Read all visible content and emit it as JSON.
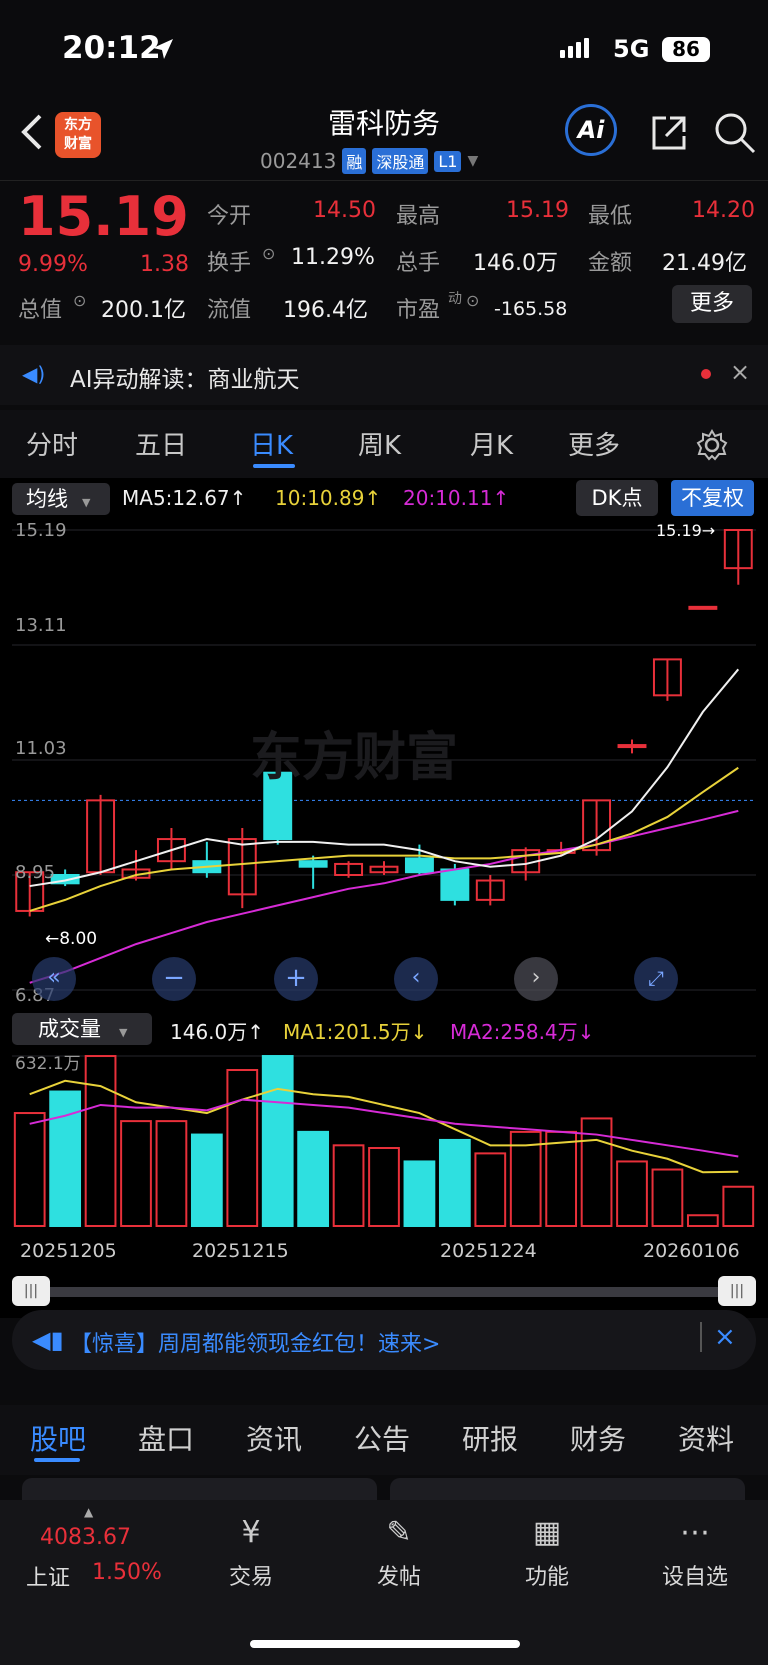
{
  "status": {
    "time": "20:12",
    "network": "5G",
    "battery": "86"
  },
  "header": {
    "title": "雷科防务",
    "code": "002413",
    "tags": [
      "融",
      "深股通",
      "L1"
    ],
    "logo_text": "东方财富",
    "ai_label": "Ai"
  },
  "quote": {
    "price": "15.19",
    "change_pct": "9.99%",
    "change": "1.38",
    "open_label": "今开",
    "open": "14.50",
    "high_label": "最高",
    "high": "15.19",
    "low_label": "最低",
    "low": "14.20",
    "turnover_label": "换手",
    "turnover": "11.29%",
    "volume_label": "总手",
    "volume": "146.0万",
    "amount_label": "金额",
    "amount": "21.49亿",
    "mktcap_label": "总值",
    "mktcap": "200.1亿",
    "float_label": "流值",
    "float": "196.4亿",
    "pe_label": "市盈",
    "pe_sup": "动",
    "pe": "-165.58",
    "more": "更多"
  },
  "ai_bar": {
    "text": "AI异动解读：商业航天"
  },
  "chart_tabs": [
    "分时",
    "五日",
    "日K",
    "周K",
    "月K",
    "更多"
  ],
  "chart_controls": {
    "ma_label": "均线",
    "ma5": "MA5:12.67↑",
    "ma10": "10:10.89↑",
    "ma20": "20:10.11↑",
    "dk": "DK点",
    "adjust": "不复权",
    "last_price_tag": "15.19→",
    "low_tag": "←8.00",
    "y_labels": [
      "15.19",
      "13.11",
      "11.03",
      "8.95",
      "6.87"
    ],
    "watermark": "东方财富"
  },
  "volume_controls": {
    "label": "成交量",
    "value": "146.0万↑",
    "ma1": "MA1:201.5万↓",
    "ma2": "MA2:258.4万↓",
    "max_label": "632.1万"
  },
  "x_labels": [
    "20251205",
    "20251215",
    "20251224",
    "20260106"
  ],
  "colors": {
    "up": "#e8303a",
    "down": "#2ee0e0",
    "ma5": "#f0f0f0",
    "ma10": "#e8d23a",
    "ma20": "#d62bd6",
    "accent": "#2a6fd6"
  },
  "chart_data": {
    "type": "candlestick",
    "candles": [
      {
        "o": 8.3,
        "c": 9.0,
        "h": 9.0,
        "l": 8.2
      },
      {
        "o": 8.95,
        "c": 8.8,
        "h": 9.05,
        "l": 8.75
      },
      {
        "o": 9.0,
        "c": 10.3,
        "h": 10.4,
        "l": 8.95
      },
      {
        "o": 9.05,
        "c": 8.9,
        "h": 9.4,
        "l": 8.85
      },
      {
        "o": 9.2,
        "c": 9.6,
        "h": 9.8,
        "l": 9.05
      },
      {
        "o": 9.2,
        "c": 9.0,
        "h": 9.55,
        "l": 8.9
      },
      {
        "o": 9.6,
        "c": 8.6,
        "h": 9.8,
        "l": 8.35
      },
      {
        "o": 10.8,
        "c": 9.6,
        "h": 10.85,
        "l": 9.5
      },
      {
        "o": 9.2,
        "c": 9.1,
        "h": 9.3,
        "l": 8.7
      },
      {
        "o": 8.95,
        "c": 9.15,
        "h": 9.2,
        "l": 8.9
      },
      {
        "o": 9.0,
        "c": 9.1,
        "h": 9.2,
        "l": 8.95
      },
      {
        "o": 9.25,
        "c": 9.0,
        "h": 9.5,
        "l": 8.95
      },
      {
        "o": 9.05,
        "c": 8.5,
        "h": 9.15,
        "l": 8.4
      },
      {
        "o": 8.5,
        "c": 8.85,
        "h": 8.95,
        "l": 8.4
      },
      {
        "o": 9.0,
        "c": 9.4,
        "h": 9.45,
        "l": 8.85
      },
      {
        "o": 9.35,
        "c": 9.4,
        "h": 9.55,
        "l": 9.3
      },
      {
        "o": 9.4,
        "c": 10.3,
        "h": 10.3,
        "l": 9.3
      },
      {
        "o": 11.3,
        "c": 11.3,
        "h": 11.4,
        "l": 11.15
      },
      {
        "o": 12.2,
        "c": 12.85,
        "h": 12.85,
        "l": 12.1
      },
      {
        "o": 13.8,
        "c": 13.8,
        "h": 13.8,
        "l": 13.8
      },
      {
        "o": 14.5,
        "c": 15.19,
        "h": 15.19,
        "l": 14.2
      }
    ],
    "ma5": [
      8.75,
      8.85,
      9.0,
      9.2,
      9.4,
      9.6,
      9.5,
      9.55,
      9.55,
      9.5,
      9.5,
      9.4,
      9.2,
      9.1,
      9.15,
      9.3,
      9.6,
      10.1,
      10.9,
      11.9,
      12.67
    ],
    "ma10": [
      8.3,
      8.5,
      8.75,
      8.95,
      9.05,
      9.1,
      9.15,
      9.2,
      9.25,
      9.3,
      9.3,
      9.3,
      9.25,
      9.25,
      9.3,
      9.35,
      9.5,
      9.7,
      10.0,
      10.45,
      10.89
    ],
    "ma20": [
      7.0,
      7.2,
      7.45,
      7.7,
      7.9,
      8.1,
      8.25,
      8.4,
      8.55,
      8.7,
      8.8,
      8.95,
      9.05,
      9.15,
      9.3,
      9.4,
      9.5,
      9.65,
      9.8,
      9.95,
      10.11
    ],
    "volume": [
      420,
      500,
      632,
      390,
      390,
      340,
      580,
      632,
      350,
      300,
      290,
      240,
      320,
      270,
      350,
      350,
      400,
      240,
      210,
      40,
      146
    ],
    "vol_ma1": [
      490,
      540,
      520,
      460,
      440,
      420,
      470,
      510,
      490,
      480,
      450,
      420,
      360,
      300,
      300,
      310,
      320,
      280,
      250,
      200,
      201.5
    ],
    "vol_ma2": [
      380,
      410,
      450,
      440,
      440,
      430,
      470,
      460,
      450,
      440,
      420,
      400,
      380,
      370,
      360,
      350,
      340,
      320,
      300,
      280,
      258.4
    ],
    "up_flags": [
      1,
      0,
      1,
      1,
      1,
      0,
      1,
      0,
      0,
      1,
      1,
      0,
      0,
      1,
      1,
      1,
      1,
      1,
      1,
      1,
      1
    ],
    "ylim": [
      6.87,
      15.19
    ],
    "vol_max": 632.1
  },
  "banner": {
    "text": "【惊喜】周周都能领现金红包！速来>"
  },
  "bottom_tabs": [
    "股吧",
    "盘口",
    "资讯",
    "公告",
    "研报",
    "财务",
    "资料"
  ],
  "nav": {
    "index_value": "4083.67",
    "index_name": "上证",
    "index_pct": "1.50%",
    "items": [
      "交易",
      "发帖",
      "功能",
      "设自选"
    ]
  }
}
